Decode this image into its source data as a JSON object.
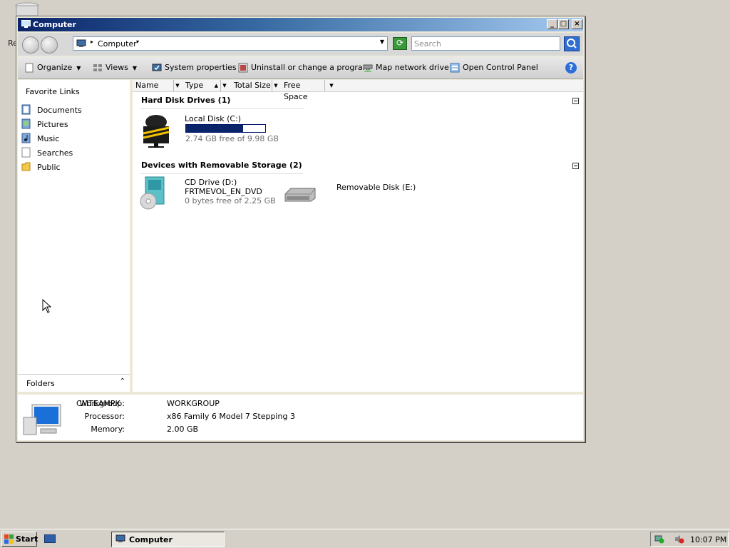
{
  "desktop": {
    "partial_label": "Re"
  },
  "window": {
    "title": "Computer",
    "buttons": {
      "minimize": "_",
      "maximize": "□",
      "close": "×"
    }
  },
  "address": {
    "breadcrumb": "Computer"
  },
  "search": {
    "placeholder": "Search"
  },
  "toolbar": {
    "organize": "Organize",
    "views": "Views",
    "system_properties": "System properties",
    "uninstall": "Uninstall or change a program",
    "map_network": "Map network drive",
    "control_panel": "Open Control Panel",
    "help": "?"
  },
  "sidebar": {
    "heading": "Favorite Links",
    "items": [
      {
        "label": "Documents",
        "icon": "documents-icon"
      },
      {
        "label": "Pictures",
        "icon": "pictures-icon"
      },
      {
        "label": "Music",
        "icon": "music-icon"
      },
      {
        "label": "Searches",
        "icon": "searches-icon"
      },
      {
        "label": "Public",
        "icon": "public-folder-icon"
      }
    ],
    "folders_label": "Folders"
  },
  "columns": [
    "Name",
    "Type",
    "Total Size",
    "Free Space"
  ],
  "groups": {
    "hdd": {
      "title": "Hard Disk Drives (1)",
      "items": [
        {
          "name": "Local Disk (C:)",
          "free_text": "2.74 GB free of 9.98 GB",
          "used_fraction": 0.725
        }
      ]
    },
    "removable": {
      "title": "Devices with Removable Storage (2)",
      "items": [
        {
          "name": "CD Drive (D:)",
          "label": "FRTMEVOL_EN_DVD",
          "free_text": "0 bytes free of 2.25 GB"
        },
        {
          "name": "Removable Disk (E:)"
        }
      ]
    }
  },
  "details": {
    "computer_name": "CMTEAMPK",
    "workgroup_label": "Workgroup:",
    "workgroup_value": "WORKGROUP",
    "processor_label": "Processor:",
    "processor_value": "x86 Family 6 Model 7 Stepping 3",
    "memory_label": "Memory:",
    "memory_value": "2.00 GB"
  },
  "taskbar": {
    "start": "Start",
    "task_window": "Computer",
    "clock": "10:07 PM"
  },
  "colors": {
    "title_gradient_start": "#0a246a",
    "progress_fill": "#0a246a",
    "window_bg": "#ece9d8",
    "desktop_bg": "#d4d0c8"
  }
}
